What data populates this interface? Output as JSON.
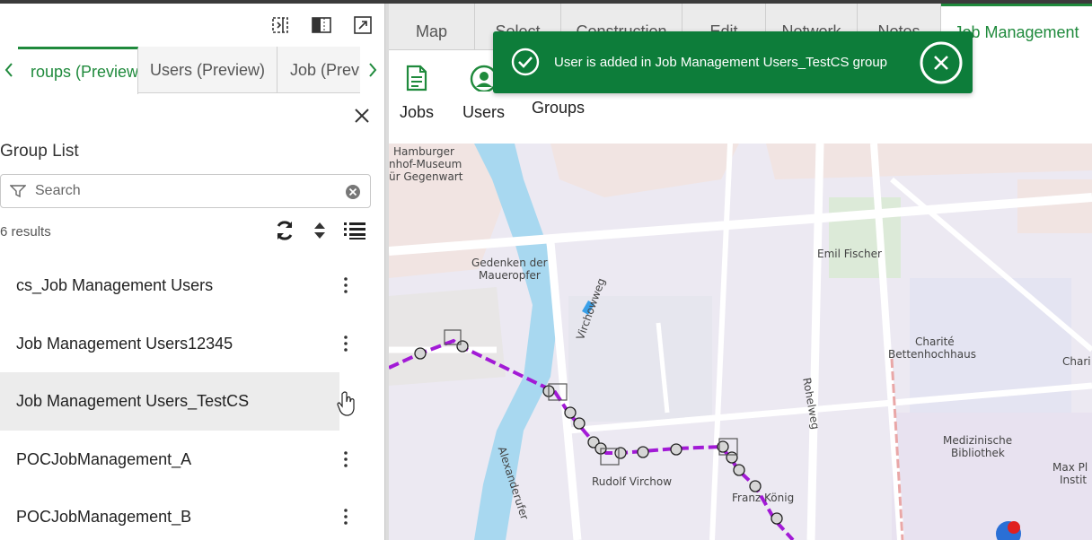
{
  "panel": {
    "tabs": [
      {
        "label": "Groups (Preview)",
        "visible": "roups (Preview)"
      },
      {
        "label": "Users (Preview)"
      },
      {
        "label": "Job (Prev"
      }
    ],
    "title": "Group List",
    "search_placeholder": "Search",
    "results": "6 results",
    "groups": [
      {
        "name": "cs_Job Management Users"
      },
      {
        "name": "Job Management Users12345"
      },
      {
        "name": "Job Management Users_TestCS"
      },
      {
        "name": "POCJobManagement_A"
      },
      {
        "name": "POCJobManagement_B"
      }
    ]
  },
  "ribbon": {
    "tabs": [
      "Map",
      "Select",
      "Construction",
      "Edit",
      "Network",
      "Notes",
      "Job Management"
    ],
    "buttons": [
      "Jobs",
      "Users",
      "Groups"
    ]
  },
  "toast": {
    "message": "User is added in Job Management Users_TestCS group"
  },
  "map": {
    "labels": [
      "Hamburger",
      "nhof-Museum",
      "ür Gegenwart",
      "Gedenken der",
      "Maueropfer",
      "Emil Fischer",
      "Virchowweg",
      "Charité",
      "Bettenhochhaus",
      "Chari",
      "Rohelweg",
      "Alexanderufer",
      "Rudolf Virchow",
      "Franz König",
      "Medizinische",
      "Bibliothek",
      "Max Pl",
      "Instit"
    ]
  },
  "colors": {
    "accent": "#1f8a3c",
    "toast_bg": "#0d7d3a",
    "route": "#a21ad6",
    "water": "#a8d8f0"
  },
  "icons": [
    "dock-panel-icon",
    "split-panel-icon",
    "popout-icon",
    "close-icon",
    "filter-icon",
    "clear-icon",
    "refresh-icon",
    "sort-icon",
    "list-view-icon",
    "kebab-icon",
    "check-circle-icon",
    "jobs-icon",
    "users-icon"
  ]
}
